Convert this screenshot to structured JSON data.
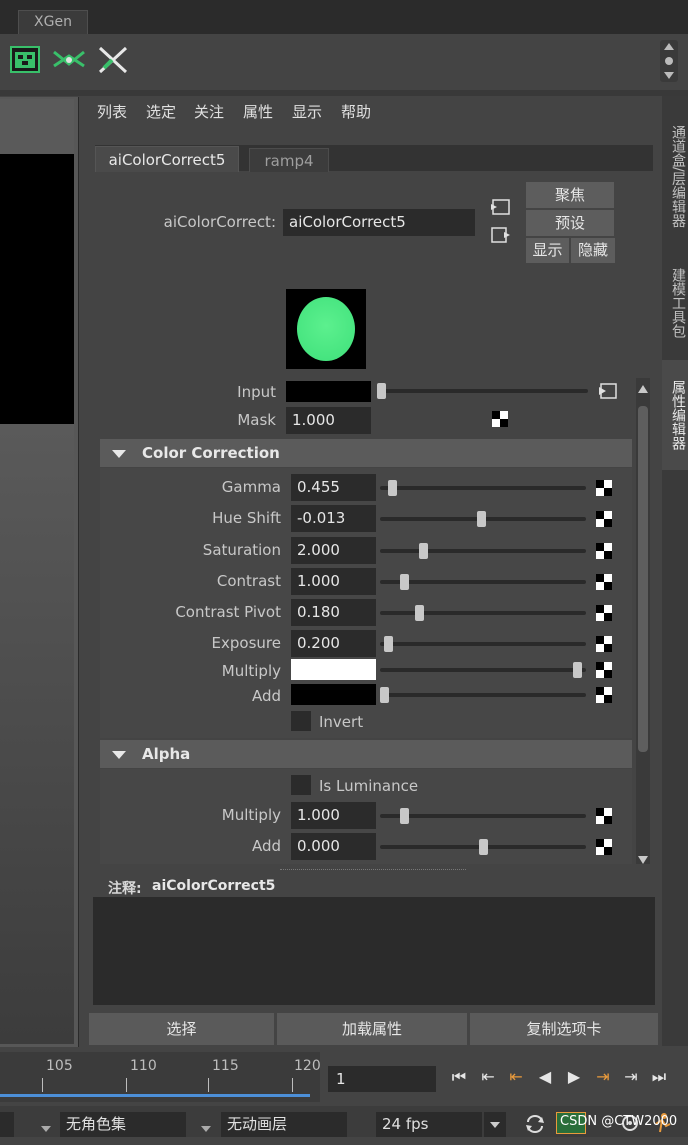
{
  "window": {
    "tab": "XGen"
  },
  "menu": [
    "列表",
    "选定",
    "关注",
    "属性",
    "显示",
    "帮助"
  ],
  "tabs": [
    {
      "label": "aiColorCorrect5"
    },
    {
      "label": "ramp4"
    }
  ],
  "node": {
    "label": "aiColorCorrect:",
    "value": "aiColorCorrect5"
  },
  "buttons": {
    "focus": "聚焦",
    "presets": "预设",
    "show": "显示",
    "hide": "隐藏"
  },
  "swatch_color": "#3ee07a",
  "top_attrs": [
    {
      "label": "Input",
      "value": ""
    },
    {
      "label": "Mask",
      "value": "1.000"
    }
  ],
  "sections": {
    "color_correction": "Color Correction",
    "alpha": "Alpha"
  },
  "color_correction": [
    {
      "label": "Gamma",
      "value": "0.455",
      "slider": 0.04
    },
    {
      "label": "Hue Shift",
      "value": "-0.013",
      "slider": 0.49
    },
    {
      "label": "Saturation",
      "value": "2.000",
      "slider": 0.2
    },
    {
      "label": "Contrast",
      "value": "1.000",
      "slider": 0.1
    },
    {
      "label": "Contrast Pivot",
      "value": "0.180",
      "slider": 0.18
    },
    {
      "label": "Exposure",
      "value": "0.200",
      "slider": 0.02
    },
    {
      "label": "Multiply",
      "color": "#ffffff",
      "slider": 0.98
    },
    {
      "label": "Add",
      "color": "#000000",
      "slider": 0.0
    }
  ],
  "invert_label": "Invert",
  "alpha": {
    "is_luminance": "Is Luminance",
    "rows": [
      {
        "label": "Multiply",
        "value": "1.000",
        "slider": 0.1
      },
      {
        "label": "Add",
        "value": "0.000",
        "slider": 0.5
      }
    ]
  },
  "notes": {
    "label": "注释:",
    "node": "aiColorCorrect5"
  },
  "bottom_buttons": [
    "选择",
    "加载属性",
    "复制选项卡"
  ],
  "side_tabs": [
    "通道盒/层编辑器",
    "建模工具包",
    "属性编辑器"
  ],
  "timeline": {
    "ticks": [
      "105",
      "110",
      "115",
      "120"
    ],
    "current_frame": "1"
  },
  "playback": [
    "⏮",
    "⇤",
    "⇤",
    "◀",
    "▶",
    "⇥",
    "⇥",
    "⏭"
  ],
  "status": {
    "character_set": "无角色集",
    "anim_layer": "无动画层",
    "fps": "24 fps",
    "watermark": "CSDN @CTW2000"
  }
}
